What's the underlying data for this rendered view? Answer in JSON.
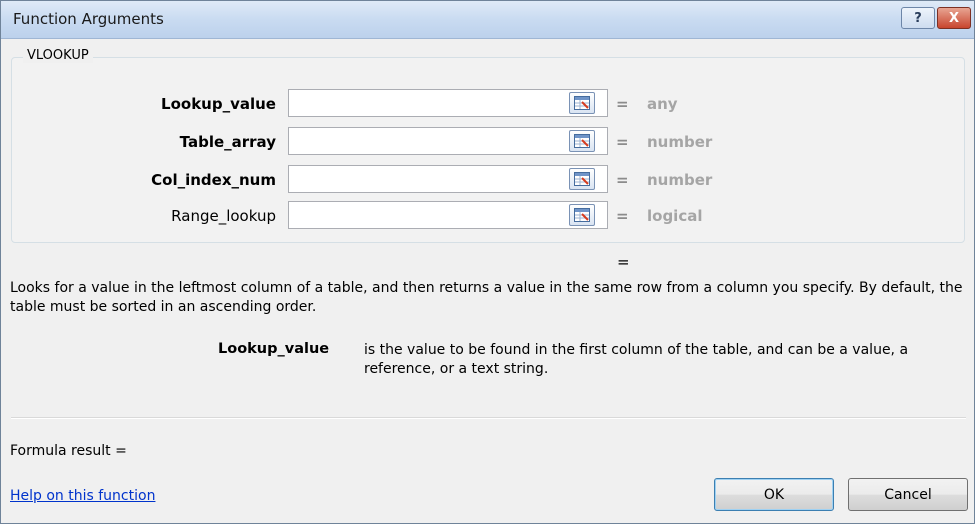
{
  "window": {
    "title": "Function Arguments",
    "help_glyph": "?",
    "close_glyph": "X"
  },
  "function_group": {
    "name": "VLOOKUP"
  },
  "arguments": [
    {
      "label": "Lookup_value",
      "value": "",
      "eq": "=",
      "type": "any"
    },
    {
      "label": "Table_array",
      "value": "",
      "eq": "=",
      "type": "number"
    },
    {
      "label": "Col_index_num",
      "value": "",
      "eq": "=",
      "type": "number"
    },
    {
      "label": "Range_lookup",
      "value": "",
      "eq": "=",
      "type": "logical"
    }
  ],
  "result_eq": "=",
  "description": "Looks for a value in the leftmost column of a table, and then returns a value in the same row from a column you specify. By default, the table must be sorted in an ascending order.",
  "arg_help": {
    "name": "Lookup_value",
    "text": "is the value to be found in the first column of the table, and can be a value, a reference, or a text string."
  },
  "formula_result": "Formula result =",
  "help_link": "Help on this function",
  "buttons": {
    "ok": "OK",
    "cancel": "Cancel"
  },
  "icons": {
    "ref_button": "collapse-dialog-icon"
  },
  "colors": {
    "type_hint": "#a5a5a5",
    "link": "#0033cc",
    "ok_border": "#3c7fb1"
  }
}
